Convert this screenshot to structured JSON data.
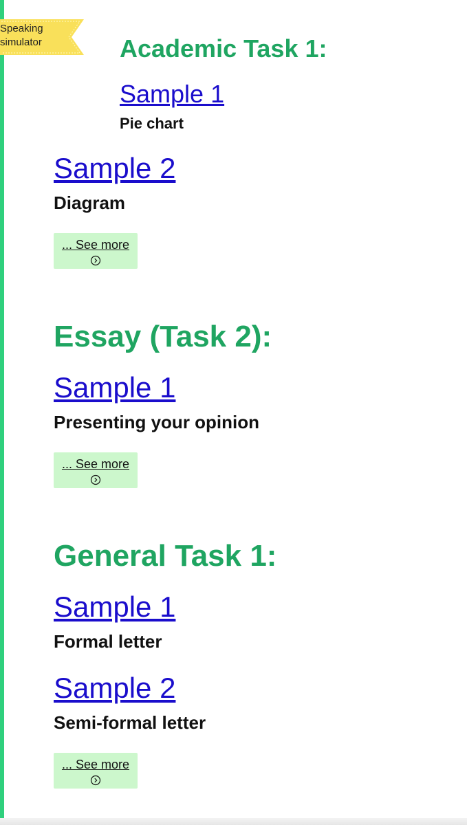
{
  "ribbon": {
    "label_line1": "Speaking",
    "label_line2": "simulator"
  },
  "academic": {
    "title": "Academic Task 1:",
    "samples": [
      {
        "link": "Sample 1",
        "desc": "Pie chart"
      },
      {
        "link": "Sample 2",
        "desc": "Diagram"
      }
    ],
    "see_more": "... See more"
  },
  "essay": {
    "title": "Essay (Task 2):",
    "samples": [
      {
        "link": "Sample 1",
        "desc": "Presenting your opinion"
      }
    ],
    "see_more": "... See more"
  },
  "general": {
    "title": "General Task 1:",
    "samples": [
      {
        "link": "Sample 1",
        "desc": "Formal letter"
      },
      {
        "link": "Sample 2",
        "desc": "Semi-formal letter"
      }
    ],
    "see_more": "... See more"
  },
  "colors": {
    "accent_green": "#1fa561",
    "left_bar": "#2fd07d",
    "link_blue": "#1a0dcc",
    "see_more_bg": "#ccf7cc",
    "ribbon_yellow": "#f9e05a"
  },
  "icons": {
    "ribbon": "ribbon-banner-icon",
    "see_more": "chevron-right-circle-icon"
  }
}
